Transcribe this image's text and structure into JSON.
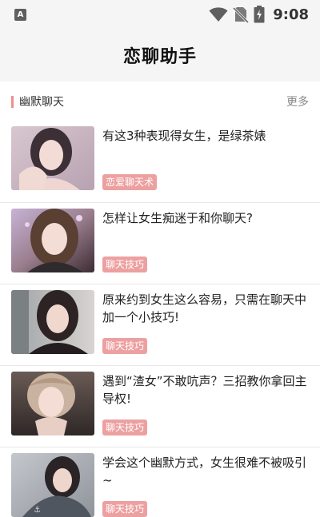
{
  "status_bar": {
    "app_badge": "A",
    "time": "9:08",
    "icons": [
      "wifi-icon",
      "no-sim-icon",
      "battery-charging-icon"
    ]
  },
  "header": {
    "title": "恋聊助手"
  },
  "section": {
    "title": "幽默聊天",
    "more_label": "更多",
    "accent_color": "#f08e8e"
  },
  "articles": [
    {
      "title": "有这3种表现得女生，是绿茶婊",
      "tag": "恋爱聊天术"
    },
    {
      "title": "怎样让女生痴迷于和你聊天?",
      "tag": "聊天技巧"
    },
    {
      "title": "原来约到女生这么容易，只需在聊天中加一个小技巧!",
      "tag": "聊天技巧"
    },
    {
      "title": "遇到“渣女”不敢吭声？三招教你拿回主导权!",
      "tag": "聊天技巧"
    },
    {
      "title": "学会这个幽默方式，女生很难不被吸引~",
      "tag": "聊天技巧"
    }
  ],
  "colors": {
    "tag_bg": "#eda0a0",
    "background": "#ffffff",
    "bar_bg": "#f5f5f5"
  }
}
